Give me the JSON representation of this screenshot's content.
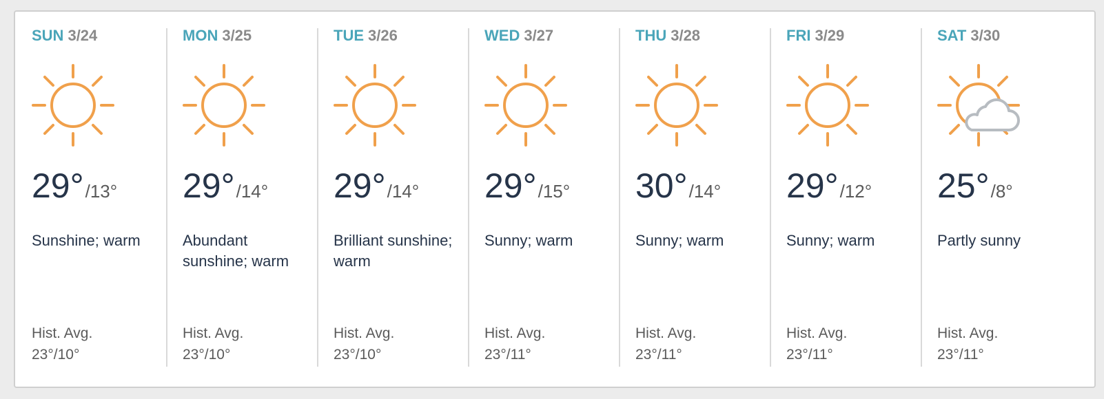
{
  "colors": {
    "day_name": "#4aa5b9",
    "date": "#8a8a8a",
    "sun": "#f0a04b",
    "cloud": "#b7bcc1",
    "temp": "#263449"
  },
  "days": [
    {
      "day": "SUN",
      "date": "3/24",
      "icon": "sun-icon",
      "high": "29°",
      "low": "/13°",
      "phrase": "Sunshine; warm",
      "hist_label": "Hist. Avg.",
      "hist_value": "23°/10°"
    },
    {
      "day": "MON",
      "date": "3/25",
      "icon": "sun-icon",
      "high": "29°",
      "low": "/14°",
      "phrase": "Abundant sunshine; warm",
      "hist_label": "Hist. Avg.",
      "hist_value": "23°/10°"
    },
    {
      "day": "TUE",
      "date": "3/26",
      "icon": "sun-icon",
      "high": "29°",
      "low": "/14°",
      "phrase": "Brilliant sunshine; warm",
      "hist_label": "Hist. Avg.",
      "hist_value": "23°/10°"
    },
    {
      "day": "WED",
      "date": "3/27",
      "icon": "sun-icon",
      "high": "29°",
      "low": "/15°",
      "phrase": "Sunny; warm",
      "hist_label": "Hist. Avg.",
      "hist_value": "23°/11°"
    },
    {
      "day": "THU",
      "date": "3/28",
      "icon": "sun-icon",
      "high": "30°",
      "low": "/14°",
      "phrase": "Sunny; warm",
      "hist_label": "Hist. Avg.",
      "hist_value": "23°/11°"
    },
    {
      "day": "FRI",
      "date": "3/29",
      "icon": "sun-icon",
      "high": "29°",
      "low": "/12°",
      "phrase": "Sunny; warm",
      "hist_label": "Hist. Avg.",
      "hist_value": "23°/11°"
    },
    {
      "day": "SAT",
      "date": "3/30",
      "icon": "partly-sunny-icon",
      "high": "25°",
      "low": "/8°",
      "phrase": "Partly sunny",
      "hist_label": "Hist. Avg.",
      "hist_value": "23°/11°"
    }
  ]
}
